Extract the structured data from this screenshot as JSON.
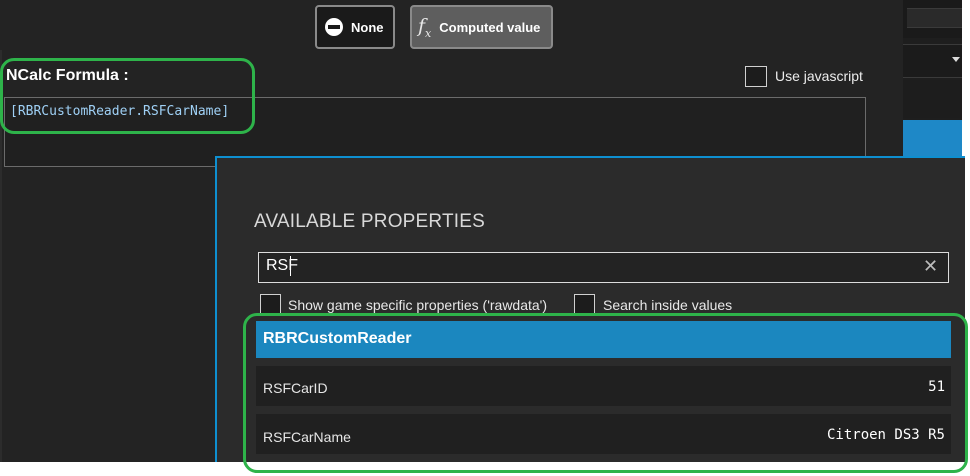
{
  "mode_buttons": {
    "none_label": "None",
    "computed_label": "Computed value"
  },
  "formula": {
    "label": "NCalc Formula :",
    "use_javascript_label": "Use javascript",
    "use_javascript_checked": false,
    "value": "[RBRCustomReader.RSFCarName]"
  },
  "properties": {
    "title": "AVAILABLE PROPERTIES",
    "search_value": "RSF",
    "show_game_specific_label": "Show game specific properties ('rawdata')",
    "show_game_specific_checked": false,
    "search_inside_values_label": "Search inside values",
    "search_inside_values_checked": false,
    "group": {
      "name": "RBRCustomReader",
      "color": "#1b87bf"
    },
    "rows": [
      {
        "name": "RSFCarID",
        "value": "51"
      },
      {
        "name": "RSFCarName",
        "value": "Citroen DS3 R5"
      }
    ]
  },
  "colors": {
    "accent_blue": "#1e88c7",
    "highlight_green": "#2eb34a",
    "background": "#232323"
  },
  "icons": [
    "none-circle-icon",
    "fx-icon",
    "clear-icon",
    "chevron-down-icon"
  ]
}
